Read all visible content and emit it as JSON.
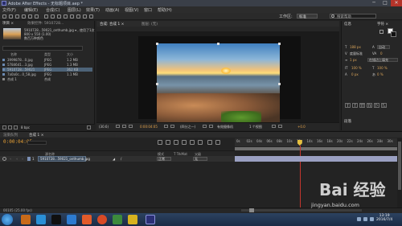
{
  "window": {
    "title": "Adobe After Effects - 无标题项目.aep *",
    "minimize": "─",
    "maximize": "□",
    "close": "✕"
  },
  "menu": [
    "文件(F)",
    "编辑(E)",
    "合成(C)",
    "图层(L)",
    "效果(T)",
    "动画(A)",
    "视图(V)",
    "窗口",
    "帮助(H)"
  ],
  "toolbar": {
    "workspace_label": "工作区:",
    "workspace_value": "标准",
    "search_placeholder": "搜索帮助"
  },
  "project_panel": {
    "tab": "项目 ×",
    "effects_tab": "效果控件: 5910728...",
    "thumb_name": "5910728...59021_onthumb.jpg ▾ , 使用了1次",
    "thumb_size": "800 x 550 (1.00)",
    "thumb_extra": "数百万种颜色",
    "columns": [
      "名称",
      "类型",
      "大小"
    ],
    "rows": [
      {
        "name": "3999878...0.jpg",
        "type": "JPEG",
        "size": "1.2 MB",
        "selected": false
      },
      {
        "name": "5784641...3.jpg",
        "type": "JPEG",
        "size": "1.3 MB",
        "selected": false
      },
      {
        "name": "5910728...59021",
        "type": "JPEG",
        "size": "362 KB",
        "selected": true
      },
      {
        "name": "7a0a0c...0_58.jpg",
        "type": "JPEG",
        "size": "1.1 MB",
        "selected": false
      },
      {
        "name": "合成 1",
        "type": "合成",
        "size": "",
        "selected": false
      }
    ],
    "bpc": "8 bpc"
  },
  "composition_panel": {
    "tab": "合成: 合成 1 ×",
    "layer_tab": "图层: (无)",
    "zoom": "(30.6)",
    "timecode": "0:00:04:05",
    "quality": "(四分之一)",
    "view": "有效摄像机",
    "views_count": "1 个视图",
    "exposure": "+0.0"
  },
  "right_panel": {
    "tab_info": "信息",
    "tab_character": "字符 ×",
    "tab_paragraph": "段落",
    "font_size": "188 px",
    "leading": "自动",
    "kerning": "度量标准",
    "tracking": "0",
    "stroke": "1 px",
    "stroke_mode": "在描边上填充",
    "vscale": "100 %",
    "hscale": "100 %",
    "baseline": "0 px",
    "tsume": "0 %",
    "style_buttons": [
      "T",
      "T",
      "TT",
      "Tt",
      "T¹",
      "T₁"
    ]
  },
  "timeline": {
    "render_tab": "渲染队列",
    "comp_tab": "合成 1 ×",
    "time": "0:00:04:05",
    "fps_text": "00105 (25.00 fps)",
    "columns": [
      "源名称",
      "模式",
      "T TrkMat",
      "父级"
    ],
    "layer": {
      "index": "1",
      "name": "5910728...59021_onthumb.jpg",
      "mode": "正常",
      "parent": "无"
    },
    "ruler_ticks": [
      "0s",
      "02s",
      "04s",
      "06s",
      "08s",
      "10s",
      "12s",
      "14s",
      "16s",
      "18s",
      "20s",
      "22s",
      "24s",
      "26s",
      "28s",
      "30s"
    ],
    "current_time_fraction": 0.4
  },
  "taskbar": {
    "clock_time": "13:19",
    "clock_date": "2016/7/4"
  },
  "watermark": {
    "main": "Bai 经验",
    "url": "jingyan.baidu.com"
  },
  "colors": {
    "accent_timecode": "#e6a035",
    "current_time_indicator": "#c5362e",
    "layer_bar": "#9aa0c2",
    "selection": "#4d6378"
  }
}
